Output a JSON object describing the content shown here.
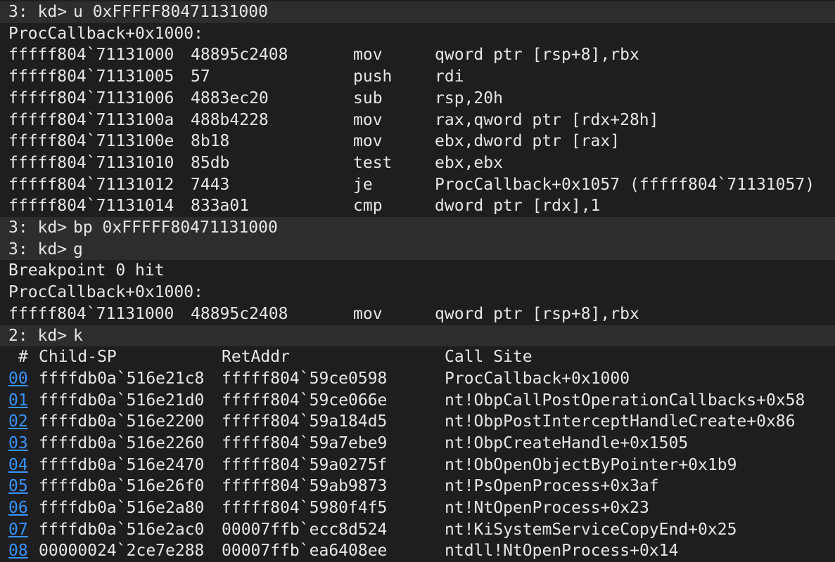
{
  "cmd1": {
    "prompt": "3: kd>",
    "text": "u 0xFFFFF80471131000"
  },
  "label1": "ProcCallback+0x1000:",
  "disasm": [
    {
      "addr": "fffff804`71131000",
      "bytes": "48895c2408",
      "mnem": "mov",
      "ops": "qword ptr [rsp+8],rbx"
    },
    {
      "addr": "fffff804`71131005",
      "bytes": "57",
      "mnem": "push",
      "ops": "rdi"
    },
    {
      "addr": "fffff804`71131006",
      "bytes": "4883ec20",
      "mnem": "sub",
      "ops": "rsp,20h"
    },
    {
      "addr": "fffff804`7113100a",
      "bytes": "488b4228",
      "mnem": "mov",
      "ops": "rax,qword ptr [rdx+28h]"
    },
    {
      "addr": "fffff804`7113100e",
      "bytes": "8b18",
      "mnem": "mov",
      "ops": "ebx,dword ptr [rax]"
    },
    {
      "addr": "fffff804`71131010",
      "bytes": "85db",
      "mnem": "test",
      "ops": "ebx,ebx"
    },
    {
      "addr": "fffff804`71131012",
      "bytes": "7443",
      "mnem": "je",
      "ops": "ProcCallback+0x1057 (fffff804`71131057)"
    },
    {
      "addr": "fffff804`71131014",
      "bytes": "833a01",
      "mnem": "cmp",
      "ops": "dword ptr [rdx],1"
    }
  ],
  "cmd2": {
    "prompt": "3: kd>",
    "text": "bp 0xFFFFF80471131000"
  },
  "cmd3": {
    "prompt": "3: kd>",
    "text": "g"
  },
  "bp_hit": "Breakpoint 0 hit",
  "label2": "ProcCallback+0x1000:",
  "disasm2": {
    "addr": "fffff804`71131000",
    "bytes": "48895c2408",
    "mnem": "mov",
    "ops": "qword ptr [rsp+8],rbx"
  },
  "cmd4": {
    "prompt": "2: kd>",
    "text": "k"
  },
  "stack_header": {
    "num": "#",
    "child_sp": "Child-SP",
    "ret_addr": "RetAddr",
    "call_site": "Call Site"
  },
  "stack": [
    {
      "frame": "00",
      "child_sp": "ffffdb0a`516e21c8",
      "ret_addr": "fffff804`59ce0598",
      "call_site": "ProcCallback+0x1000"
    },
    {
      "frame": "01",
      "child_sp": "ffffdb0a`516e21d0",
      "ret_addr": "fffff804`59ce066e",
      "call_site": "nt!ObpCallPostOperationCallbacks+0x58"
    },
    {
      "frame": "02",
      "child_sp": "ffffdb0a`516e2200",
      "ret_addr": "fffff804`59a184d5",
      "call_site": "nt!ObpPostInterceptHandleCreate+0x86"
    },
    {
      "frame": "03",
      "child_sp": "ffffdb0a`516e2260",
      "ret_addr": "fffff804`59a7ebe9",
      "call_site": "nt!ObpCreateHandle+0x1505"
    },
    {
      "frame": "04",
      "child_sp": "ffffdb0a`516e2470",
      "ret_addr": "fffff804`59a0275f",
      "call_site": "nt!ObOpenObjectByPointer+0x1b9"
    },
    {
      "frame": "05",
      "child_sp": "ffffdb0a`516e26f0",
      "ret_addr": "fffff804`59ab9873",
      "call_site": "nt!PsOpenProcess+0x3af"
    },
    {
      "frame": "06",
      "child_sp": "ffffdb0a`516e2a80",
      "ret_addr": "fffff804`5980f4f5",
      "call_site": "nt!NtOpenProcess+0x23"
    },
    {
      "frame": "07",
      "child_sp": "ffffdb0a`516e2ac0",
      "ret_addr": "00007ffb`ecc8d524",
      "call_site": "nt!KiSystemServiceCopyEnd+0x25"
    },
    {
      "frame": "08",
      "child_sp": "00000024`2ce7e288",
      "ret_addr": "00007ffb`ea6408ee",
      "call_site": "ntdll!NtOpenProcess+0x14"
    }
  ],
  "colors": {
    "background": "#1e1e1e",
    "highlight": "#2d2d2d",
    "text": "#e6e6e6",
    "link": "#3794ff"
  }
}
